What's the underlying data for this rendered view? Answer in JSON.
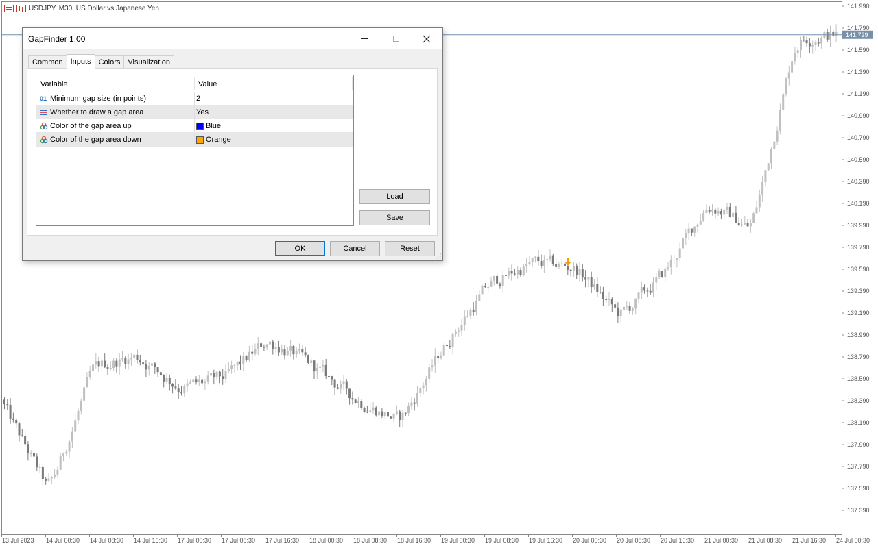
{
  "chart": {
    "header_text": "USDJPY, M30:  US Dollar vs Japanese Yen",
    "price_labels": [
      "141.990",
      "141.790",
      "141.590",
      "141.390",
      "141.190",
      "140.990",
      "140.790",
      "140.590",
      "140.390",
      "140.190",
      "139.990",
      "139.790",
      "139.590",
      "139.390",
      "139.190",
      "138.990",
      "138.790",
      "138.590",
      "138.390",
      "138.190",
      "137.990",
      "137.790",
      "137.590",
      "137.390"
    ],
    "current_price": "141.729",
    "time_labels": [
      "13 Jul 2023",
      "14 Jul 00:30",
      "14 Jul 08:30",
      "14 Jul 16:30",
      "17 Jul 00:30",
      "17 Jul 08:30",
      "17 Jul 16:30",
      "18 Jul 00:30",
      "18 Jul 08:30",
      "18 Jul 16:30",
      "19 Jul 00:30",
      "19 Jul 08:30",
      "19 Jul 16:30",
      "20 Jul 00:30",
      "20 Jul 08:30",
      "20 Jul 16:30",
      "21 Jul 00:30",
      "21 Jul 08:30",
      "21 Jul 16:30",
      "24 Jul 00:30"
    ],
    "colors": {
      "bull": "#c0c0c0",
      "bear": "#7a7a7a",
      "price_line": "#7090b0",
      "arrow": "#f39c12",
      "axis_label_bg": "#7890a8"
    }
  },
  "chart_data": {
    "type": "candlestick",
    "title": "USDJPY, M30:  US Dollar vs Japanese Yen",
    "x": [
      "13 Jul 2023",
      "14 Jul 00:30",
      "14 Jul 08:30",
      "14 Jul 16:30",
      "17 Jul 00:30",
      "17 Jul 08:30",
      "17 Jul 16:30",
      "18 Jul 00:30",
      "18 Jul 08:30",
      "18 Jul 16:30",
      "19 Jul 00:30",
      "19 Jul 08:30",
      "19 Jul 16:30",
      "20 Jul 00:30",
      "20 Jul 08:30",
      "20 Jul 16:30",
      "21 Jul 00:30",
      "21 Jul 08:30",
      "21 Jul 16:30",
      "24 Jul 00:30"
    ],
    "close_approx": [
      138.3,
      137.55,
      138.7,
      138.8,
      138.5,
      138.6,
      138.95,
      138.7,
      138.4,
      138.2,
      138.9,
      139.45,
      139.65,
      139.6,
      139.15,
      139.55,
      140.2,
      139.95,
      141.7,
      141.73
    ],
    "ylim": [
      137.25,
      142.05
    ],
    "last_price": 141.729,
    "grid": false
  },
  "dialog": {
    "title": "GapFinder 1.00",
    "tabs": [
      "Common",
      "Inputs",
      "Colors",
      "Visualization"
    ],
    "active_tab": "Inputs",
    "columns": {
      "variable": "Variable",
      "value": "Value"
    },
    "rows": [
      {
        "icon": "int-icon",
        "glyph": "01",
        "variable": "Minimum gap size (in points)",
        "value": "2"
      },
      {
        "icon": "bool-icon",
        "glyph": "",
        "variable": "Whether to draw a gap area",
        "value": "Yes"
      },
      {
        "icon": "color-icon",
        "glyph": "",
        "variable": "Color of the gap area up",
        "value": "Blue",
        "swatch": "#0000ff"
      },
      {
        "icon": "color-icon",
        "glyph": "",
        "variable": "Color of the gap area down",
        "value": "Orange",
        "swatch": "#ffa500"
      }
    ],
    "buttons": {
      "load": "Load",
      "save": "Save",
      "ok": "OK",
      "cancel": "Cancel",
      "reset": "Reset"
    }
  }
}
